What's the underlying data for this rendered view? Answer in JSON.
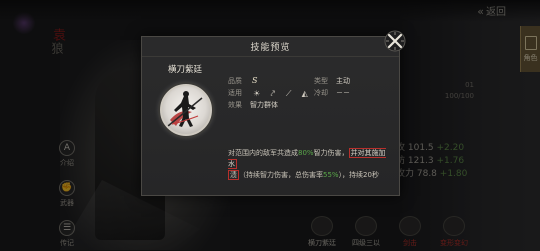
{
  "top_bar": {
    "back_label": "返回"
  },
  "left_panel": {
    "emblem_main": "袁",
    "emblem_sub": "狼",
    "side_buttons": [
      {
        "icon": "info-icon",
        "glyph": "A",
        "label": "介绍"
      },
      {
        "icon": "fist-icon",
        "glyph": "✊",
        "label": "武器"
      },
      {
        "icon": "scroll-icon",
        "glyph": "☰",
        "label": "传记"
      }
    ]
  },
  "right_panel": {
    "tab_label": "角色",
    "rows": [
      "01",
      "100/100"
    ],
    "stats": [
      {
        "prefix": "",
        "value": "攻 101.5",
        "bonus": "+2.20"
      },
      {
        "prefix": "",
        "value": "防 121.3",
        "bonus": "+1.76"
      },
      {
        "prefix": "",
        "value": "攻力 78.8",
        "bonus": "+1.80"
      }
    ],
    "tabs": [
      {
        "label": "横刀紫廷",
        "red": false
      },
      {
        "label": "四级三以",
        "red": false
      },
      {
        "label": "剑击",
        "red": true
      },
      {
        "label": "变形变幻",
        "red": true
      }
    ]
  },
  "dialog": {
    "title": "技能预览",
    "skill_name": "横刀紫廷",
    "grade_label": "品质",
    "grade_value": "S",
    "type_label": "类型",
    "type_value": "主动",
    "applicable_label": "适用",
    "weapons": [
      "sun-icon",
      "bow-icon",
      "spear-icon",
      "fan-icon"
    ],
    "cooldown_label": "冷却",
    "cooldown_value": "－－",
    "effect_label": "效果",
    "effect_value": "智力群体",
    "desc_part1": "对范围内的敌军共造成",
    "desc_pct1": "80%",
    "desc_part2": "智力伤害，",
    "desc_hl1": "并对其施加水",
    "desc_hl2": "渍",
    "desc_part3": "（持续智力伤害，总伤害率",
    "desc_pct2": "55%",
    "desc_part4": "），持续20秒"
  }
}
